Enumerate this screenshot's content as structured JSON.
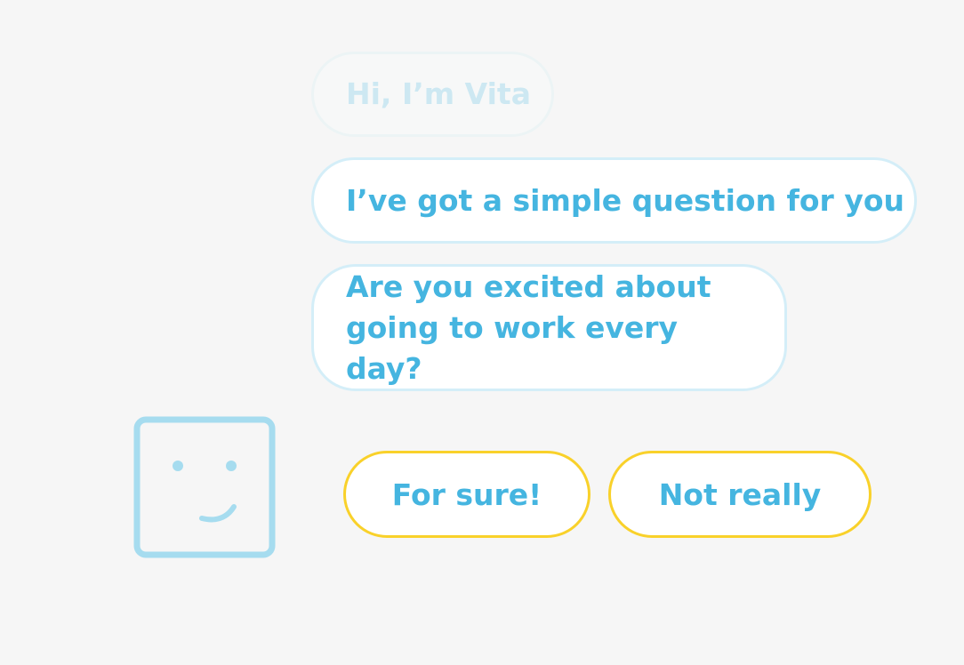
{
  "chat": {
    "messages": [
      "Hi, I’m Vita",
      "I’ve got a simple question for you"
    ],
    "question": {
      "line1": "Are you excited about",
      "line2": "going to work every day?"
    }
  },
  "answers": {
    "yes_label": "For sure!",
    "no_label": "Not really"
  },
  "avatar": {
    "icon": "smiley-face-icon"
  },
  "colors": {
    "text_accent": "#45b5e0",
    "bubble_border": "#d4eef8",
    "answer_border": "#f9d12a",
    "avatar_stroke": "#a6dcef",
    "background": "#f6f6f6"
  }
}
